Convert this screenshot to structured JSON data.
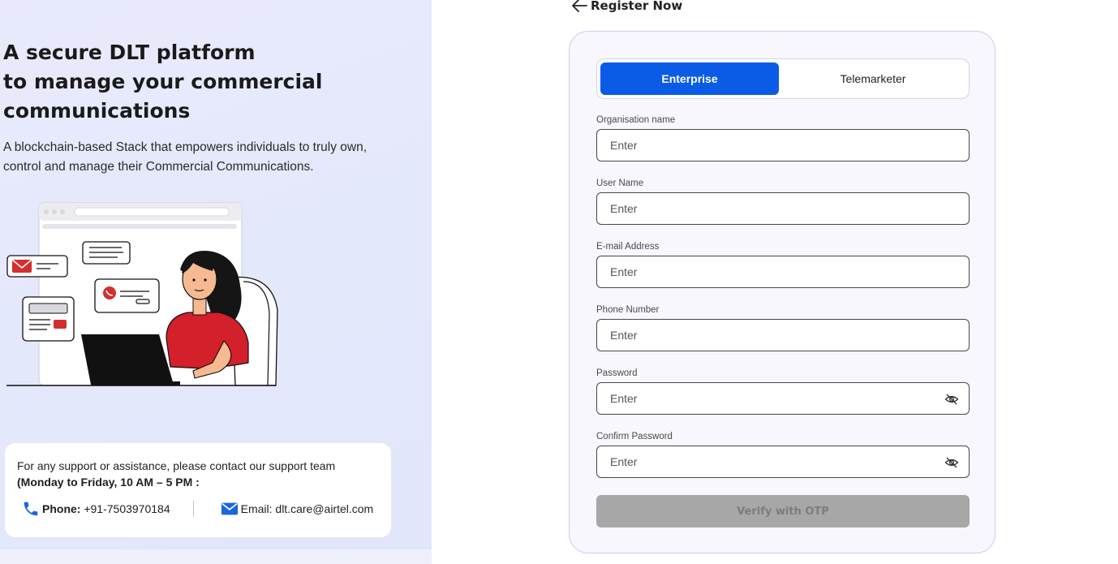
{
  "left_panel": {
    "title_lines": [
      "A secure DLT platform",
      "to manage your commercial",
      "communications"
    ],
    "subtitle_lines": [
      "A blockchain-based Stack that empowers individuals to truly own,",
      "control and manage their Commercial Communications."
    ],
    "support": {
      "text": "For any support or assistance, please contact our support team",
      "hours": "(Monday to Friday, 10 AM – 5 PM :",
      "phone_label": "Phone:",
      "phone_value": "+91-7503970184",
      "email_text": "Email: dlt.care@airtel.com"
    }
  },
  "header": {
    "back_label": "Register Now"
  },
  "form": {
    "tabs": [
      {
        "label": "Enterprise",
        "active": true
      },
      {
        "label": "Telemarketer",
        "active": false
      }
    ],
    "fields": [
      {
        "label": "Organisation name",
        "placeholder": "Enter",
        "value": ""
      },
      {
        "label": "User Name",
        "placeholder": "Enter",
        "value": ""
      },
      {
        "label": "E-mail Address",
        "placeholder": "Enter",
        "value": ""
      },
      {
        "label": "Phone Number",
        "placeholder": "Enter",
        "value": ""
      },
      {
        "label": "Password",
        "placeholder": "Enter",
        "value": ""
      },
      {
        "label": "Confirm Password",
        "placeholder": "Enter",
        "value": ""
      }
    ],
    "submit_label": "Verify with OTP",
    "submit_disabled": true
  },
  "colors": {
    "primary": "#0a5ce6",
    "disabled_button": "#a7a7a7",
    "card_border": "#c9cdf0"
  },
  "icons": [
    "back-arrow-icon",
    "eye-off-icon",
    "phone-icon",
    "mail-icon"
  ]
}
